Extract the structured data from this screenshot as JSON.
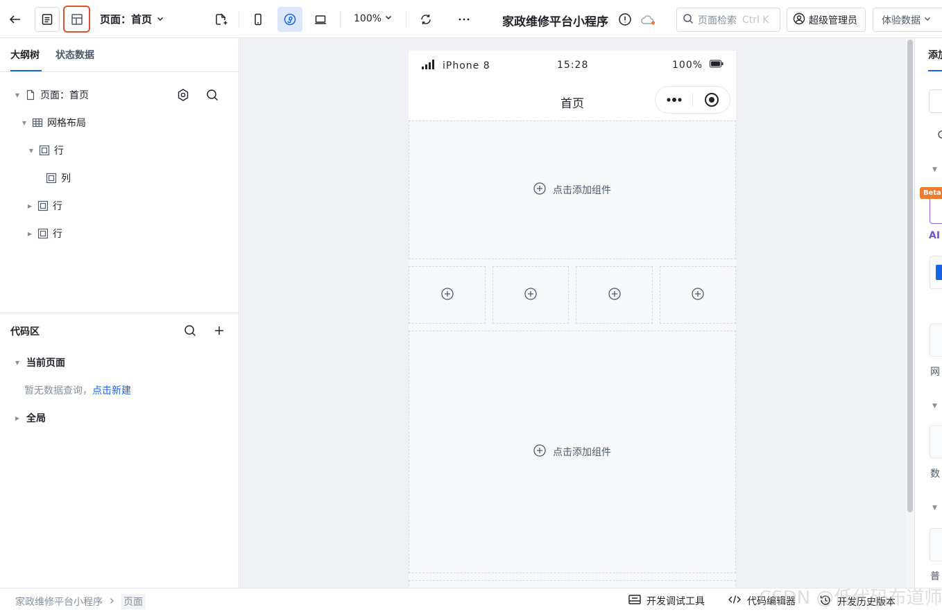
{
  "toolbar": {
    "page_label": "页面：首页",
    "zoom": "100%",
    "app_title": "家政维修平台小程序",
    "search_placeholder": "页面检索",
    "search_shortcut": "Ctrl K",
    "user": "超级管理员",
    "data_mode": "体验数据"
  },
  "left": {
    "tabs": [
      "大纲树",
      "状态数据"
    ],
    "tree": [
      {
        "label": "页面：首页"
      },
      {
        "label": "网格布局"
      },
      {
        "label": "行"
      },
      {
        "label": "列"
      },
      {
        "label": "行"
      },
      {
        "label": "行"
      }
    ],
    "code": {
      "title": "代码区",
      "current_page": "当前页面",
      "empty_text": "暂无数据查询，",
      "create_link": "点击新建",
      "global": "全局"
    }
  },
  "phone": {
    "carrier": "iPhone 8",
    "time": "15:28",
    "battery": "100%",
    "nav_title": "首页",
    "add_component": "点击添加组件"
  },
  "right": {
    "tab": "添加",
    "beta": "Beta",
    "ai": "AI",
    "labels": [
      "网",
      "数",
      "普"
    ]
  },
  "footer": {
    "breadcrumb_app": "家政维修平台小程序",
    "breadcrumb_page": "页面",
    "debug": "开发调试工具",
    "code_editor": "代码编辑器",
    "history": "开发历史版本"
  },
  "watermark": "CSDN @低代码布道师",
  "colors": {
    "accent": "#1463e8",
    "highlight": "#e0502c",
    "beta": "#f07a2b",
    "ai": "#7b4fe0"
  }
}
